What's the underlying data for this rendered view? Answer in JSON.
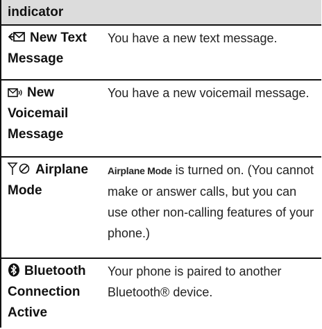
{
  "table": {
    "header": "indicator",
    "rows": [
      {
        "icon": "new-text-message-icon",
        "name": "New Text Message",
        "desc_term": "",
        "description": "You have a new text message."
      },
      {
        "icon": "new-voicemail-icon",
        "name": "New Voicemail Message",
        "desc_term": "",
        "description": "You have a new voicemail message."
      },
      {
        "icon": "airplane-mode-icon",
        "name": "Airplane Mode",
        "desc_term": "Airplane Mode",
        "description": " is turned on. (You cannot make or answer calls, but you can use other non-calling features of your phone.)"
      },
      {
        "icon": "bluetooth-icon",
        "name": "Bluetooth Connection Active",
        "desc_term": "",
        "description": "Your phone is paired to another Bluetooth® device."
      }
    ]
  }
}
